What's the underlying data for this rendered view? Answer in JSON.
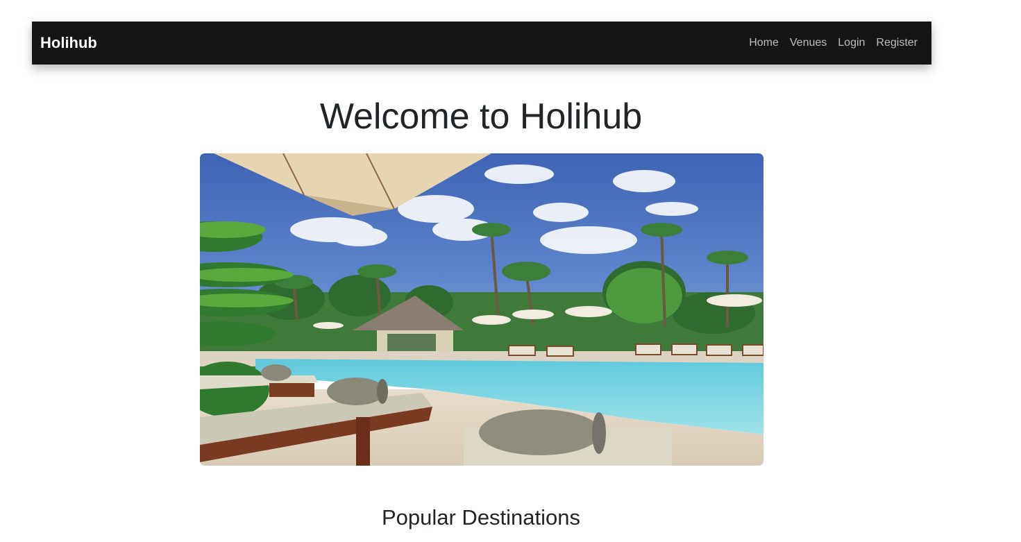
{
  "navbar": {
    "brand": "Holihub",
    "links": [
      {
        "label": "Home"
      },
      {
        "label": "Venues"
      },
      {
        "label": "Login"
      },
      {
        "label": "Register"
      }
    ]
  },
  "main": {
    "title": "Welcome to Holihub",
    "section_heading": "Popular Destinations"
  },
  "colors": {
    "navbar_bg": "#151515",
    "brand_text": "#ffffff",
    "nav_link_text": "#bdbdbd",
    "heading_text": "#212529"
  }
}
